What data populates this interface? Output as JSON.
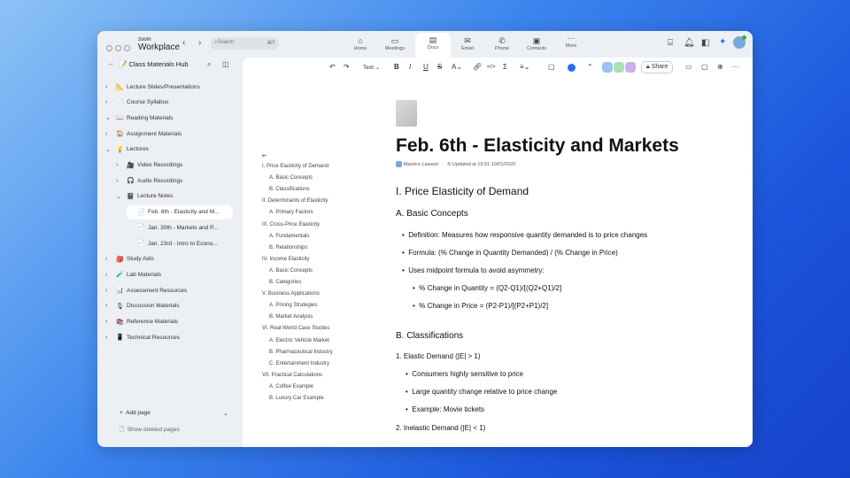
{
  "app": {
    "brand_top": "zoom",
    "brand": "Workplace",
    "search_placeholder": "Search",
    "search_shortcut": "⌘F"
  },
  "nav": [
    {
      "label": "Home",
      "icon": "⌂"
    },
    {
      "label": "Meetings",
      "icon": "▭"
    },
    {
      "label": "Docs",
      "icon": "▤"
    },
    {
      "label": "Email",
      "icon": "✉"
    },
    {
      "label": "Phone",
      "icon": "✆"
    },
    {
      "label": "Contacts",
      "icon": "▣"
    },
    {
      "label": "More",
      "icon": "···"
    }
  ],
  "sidebar": {
    "title": "Class Materials Hub",
    "items": [
      {
        "label": "Lecture Slides/Presentations",
        "icon": "📐"
      },
      {
        "label": "Course Syllabus",
        "icon": "📄"
      },
      {
        "label": "Reading Materials",
        "icon": "📖"
      },
      {
        "label": "Assignment Materials",
        "icon": "🏠"
      },
      {
        "label": "Lectures",
        "icon": "💡"
      },
      {
        "label": "Video Recordings",
        "icon": "🎥"
      },
      {
        "label": "Audio Recordings",
        "icon": "🎧"
      },
      {
        "label": "Lecture Notes",
        "icon": "📓"
      },
      {
        "label": "Feb. 6th - Elasticity and M...",
        "icon": "📄"
      },
      {
        "label": "Jan. 30th - Markets and P...",
        "icon": "📄"
      },
      {
        "label": "Jan. 23rd - Intro to Econo...",
        "icon": "📄"
      },
      {
        "label": "Study Aids",
        "icon": "🎒"
      },
      {
        "label": "Lab Materials",
        "icon": "🧪"
      },
      {
        "label": "Assessment Resources",
        "icon": "📊"
      },
      {
        "label": "Discussion Materials",
        "icon": "🎙"
      },
      {
        "label": "Reference Materials",
        "icon": "📚"
      },
      {
        "label": "Technical Resources",
        "icon": "📱"
      }
    ],
    "add_page": "Add page",
    "show_deleted": "Show deleted pages"
  },
  "toolbar": {
    "text_style": "Text",
    "share": "Share"
  },
  "toc": [
    "I. Price Elasticity of Demand",
    "A. Basic Concepts",
    "B. Classifications",
    "II. Determinants of Elasticity",
    "A. Primary Factors",
    "III. Cross-Price Elasticity",
    "A. Fundamentals",
    "B. Relationships",
    "IV. Income Elasticity",
    "A. Basic Concepts",
    "B. Categories",
    "V. Business Applications",
    "A. Pricing Strategies",
    "B. Market Analysis",
    "VI. Real-World Case Studies",
    "A. Electric Vehicle Market",
    "B. Pharmaceutical Industry",
    "C. Entertainment Industry",
    "VII. Practical Calculations",
    "A. Coffee Example",
    "B. Luxury Car Example"
  ],
  "doc": {
    "title": "Feb. 6th - Elasticity and Markets",
    "author": "Maurice Lawson",
    "updated": "Updated at 19:01 10/01/2020",
    "h1": "I. Price Elasticity of Demand",
    "h2a": "A. Basic Concepts",
    "b1": "Definition: Measures how responsive quantity demanded is to price changes",
    "b2": "Formula: (% Change in Quantity Demanded) / (% Change in Price)",
    "b3": "Uses midpoint formula to avoid asymmetry:",
    "b3a": "% Change in Quantity = (Q2-Q1)/[(Q2+Q1)/2]",
    "b3b": "% Change in Price = (P2-P1)/[(P2+P1)/2]",
    "h2b": "B. Classifications",
    "n1": "1. Elastic Demand (|E| > 1)",
    "n1a": "Consumers highly sensitive to price",
    "n1b": "Large quantity change relative to price change",
    "n1c": "Example: Movie tickets",
    "n2": "2. Inelastic Demand (|E| < 1)"
  }
}
